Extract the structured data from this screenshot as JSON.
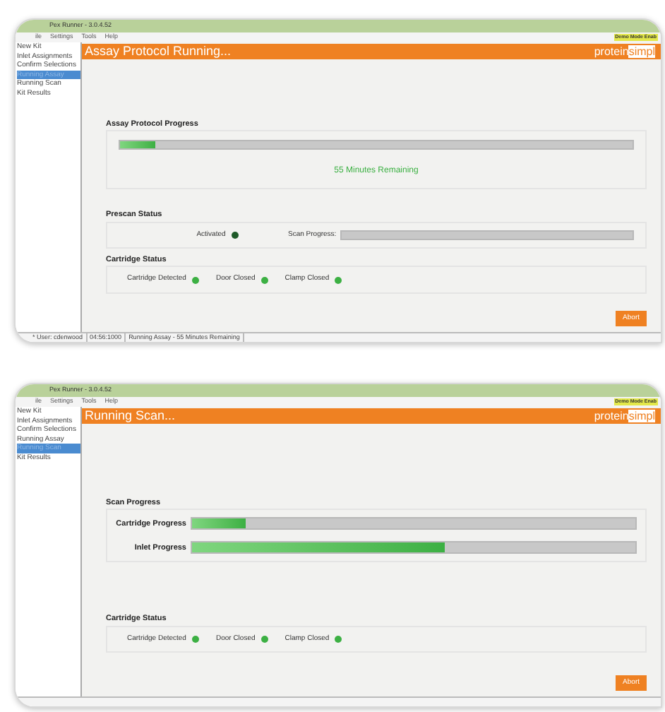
{
  "windows": [
    {
      "title_bar": "Pex Runner - 3.0.4.52",
      "menu": [
        "ile",
        "Settings",
        "Tools",
        "Help"
      ],
      "demo_badge": "Demo Mode Enab",
      "sidebar": [
        {
          "label": "New Kit",
          "selected": false
        },
        {
          "label": "Inlet Assignments",
          "selected": false
        },
        {
          "label": "Confirm Selections",
          "selected": false
        },
        {
          "label": "Running Assay",
          "selected": true
        },
        {
          "label": "Running Scan",
          "selected": false
        },
        {
          "label": "Kit Results",
          "selected": false
        }
      ],
      "header": "Assay Protocol Running...",
      "brand": [
        "protein",
        "simpl"
      ],
      "sections": [
        {
          "kind": "progress",
          "title": "Assay Protocol Progress",
          "level": 0.07,
          "remaining": "55 Minutes Remaining"
        },
        {
          "kind": "prescan",
          "title": "Prescan Status",
          "indicators": [
            {
              "label": "Activated",
              "color": "#1e5a28"
            }
          ],
          "bar_label": "Scan Progress:"
        },
        {
          "kind": "lights",
          "title": "Cartridge Status",
          "indicators": [
            {
              "label": "Cartridge Detected",
              "color": "#3cb043"
            },
            {
              "label": "Door Closed",
              "color": "#3cb043"
            },
            {
              "label": "Clamp Closed",
              "color": "#3cb043"
            }
          ]
        }
      ],
      "abort": "Abort",
      "status_bar": [
        "* User: cdenwood",
        "04:56:1000",
        "Running Assay - 55 Minutes Remaining"
      ]
    },
    {
      "title_bar": "Pex Runner - 3.0.4.52",
      "menu": [
        "ile",
        "Settings",
        "Tools",
        "Help"
      ],
      "demo_badge": "Demo Mode Enab",
      "sidebar": [
        {
          "label": "New Kit",
          "selected": false
        },
        {
          "label": "Inlet Assignments",
          "selected": false
        },
        {
          "label": "Confirm Selections",
          "selected": false
        },
        {
          "label": "Running Assay",
          "selected": false
        },
        {
          "label": "Running Scan",
          "selected": true
        },
        {
          "label": "Kit Results",
          "selected": false
        }
      ],
      "header": "Running Scan...",
      "brand": [
        "protein",
        "simpl"
      ],
      "sections": [
        {
          "kind": "bars",
          "title": "Scan Progress",
          "bars": [
            {
              "label": "Cartridge Progress",
              "level": 0.12
            },
            {
              "label": "Inlet Progress",
              "level": 0.57
            }
          ]
        },
        {
          "kind": "lights",
          "title": "Cartridge Status",
          "indicators": [
            {
              "label": "Cartridge Detected",
              "color": "#3cb043"
            },
            {
              "label": "Door Closed",
              "color": "#3cb043"
            },
            {
              "label": "Clamp Closed",
              "color": "#3cb043"
            }
          ]
        }
      ],
      "abort": "Abort"
    }
  ]
}
